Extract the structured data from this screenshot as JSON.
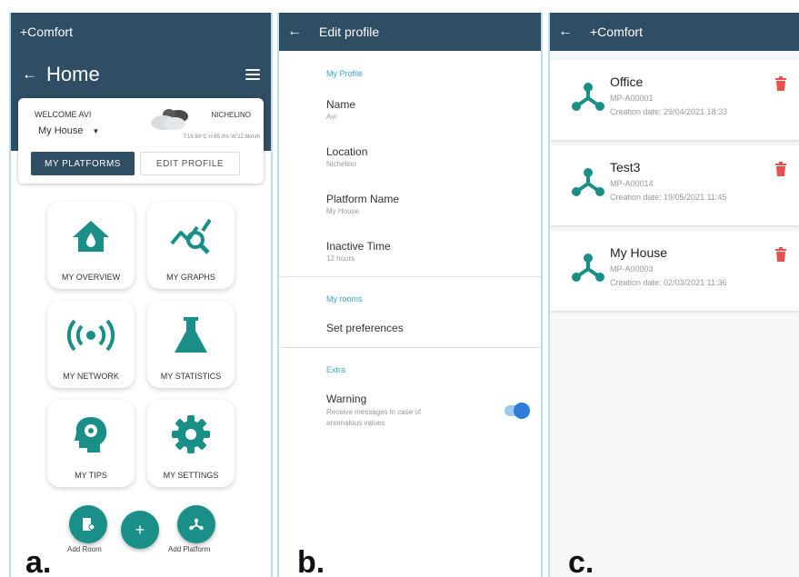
{
  "panel_a": {
    "status_title": "+Comfort",
    "title": "Home",
    "welcome": "WELCOME AVI",
    "house": "My House",
    "city": "NICHELINO",
    "weather": "T:16.99°C H:65.0% W:12.6km/h",
    "btn_platforms": "MY PLATFORMS",
    "btn_edit": "EDIT PROFILE",
    "tiles": [
      {
        "label": "MY OVERVIEW",
        "icon": "home-drop-icon"
      },
      {
        "label": "MY GRAPHS",
        "icon": "chart-search-icon"
      },
      {
        "label": "MY NETWORK",
        "icon": "wireless-icon"
      },
      {
        "label": "MY STATISTICS",
        "icon": "flask-icon"
      },
      {
        "label": "MY TIPS",
        "icon": "head-gear-icon"
      },
      {
        "label": "MY SETTINGS",
        "icon": "gear-icon"
      }
    ],
    "add_room": "Add Room",
    "add_platform": "Add Platform",
    "fab_plus": "+",
    "letter": "a."
  },
  "panel_b": {
    "title": "Edit profile",
    "section_profile": "My Profile",
    "fields": [
      {
        "label": "Name",
        "value": "Avi"
      },
      {
        "label": "Location",
        "value": "Nichelino"
      },
      {
        "label": "Platform Name",
        "value": "My House"
      },
      {
        "label": "Inactive Time",
        "value": "12 hours"
      }
    ],
    "section_rooms": "My rooms",
    "set_preferences": "Set preferences",
    "section_extra": "Extra",
    "warning_label": "Warning",
    "warning_desc_1": "Receive messages in case of",
    "warning_desc_2": "anomalous values",
    "warning_enabled": true,
    "letter": "b."
  },
  "panel_c": {
    "title": "+Comfort",
    "platforms": [
      {
        "name": "Office",
        "code": "MP-A00001",
        "date": "Creation date: 29/04/2021 18:33"
      },
      {
        "name": "Test3",
        "code": "MP-A00014",
        "date": "Creation date: 19/05/2021 11:45"
      },
      {
        "name": "My House",
        "code": "MP-A00003",
        "date": "Creation date: 02/03/2021 11:36"
      }
    ],
    "letter": "c."
  },
  "colors": {
    "header": "#2f4d63",
    "teal": "#1a8f87",
    "link_blue": "#3aa5c8",
    "delete_red": "#e8504e",
    "toggle_blue": "#2f7ddb"
  }
}
